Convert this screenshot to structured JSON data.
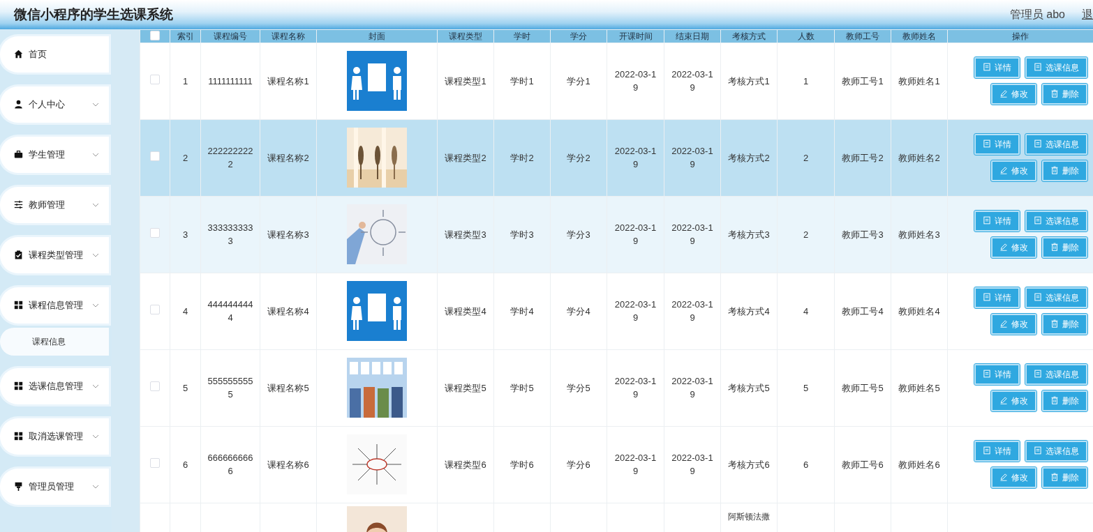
{
  "header": {
    "title": "微信小程序的学生选课系统",
    "user": "管理员 abo",
    "logout": "退"
  },
  "sidebar": {
    "items": [
      {
        "label": "首页",
        "kind": "home",
        "expandable": false
      },
      {
        "label": "个人中心",
        "kind": "person",
        "expandable": true
      },
      {
        "label": "学生管理",
        "kind": "briefcase",
        "expandable": true
      },
      {
        "label": "教师管理",
        "kind": "sliders",
        "expandable": true
      },
      {
        "label": "课程类型管理",
        "kind": "clipboard",
        "expandable": true
      },
      {
        "label": "课程信息管理",
        "kind": "grid",
        "expandable": true,
        "children": [
          {
            "label": "课程信息"
          }
        ]
      },
      {
        "label": "选课信息管理",
        "kind": "grid",
        "expandable": true
      },
      {
        "label": "取消选课管理",
        "kind": "grid",
        "expandable": true
      },
      {
        "label": "管理员管理",
        "kind": "pin",
        "expandable": true
      }
    ]
  },
  "table": {
    "header_checked": false,
    "columns": [
      "索引",
      "课程编号",
      "课程名称",
      "封面",
      "课程类型",
      "学时",
      "学分",
      "开课时间",
      "结束日期",
      "考核方式",
      "人数",
      "教师工号",
      "教师姓名",
      "操作"
    ],
    "rows": [
      {
        "checked": false,
        "selected": false,
        "hovered": false,
        "index": "1",
        "code": "1111111111",
        "name": "课程名称1",
        "type": "课程类型1",
        "hours": "学时1",
        "credits": "学分1",
        "start": "2022-03-19",
        "end": "2022-03-19",
        "assessment": "考核方式1",
        "count": "1",
        "teacher_id": "教师工号1",
        "teacher_name": "教师姓名1",
        "actions": [
          {
            "kind": "doc",
            "label": "详情"
          },
          {
            "kind": "doc",
            "label": "选课信息"
          },
          {
            "kind": "edit",
            "label": "修改"
          },
          {
            "kind": "delete",
            "label": "删除"
          }
        ]
      },
      {
        "checked": false,
        "selected": true,
        "hovered": false,
        "index": "2",
        "code": "2222222222",
        "name": "课程名称2",
        "type": "课程类型2",
        "hours": "学时2",
        "credits": "学分2",
        "start": "2022-03-19",
        "end": "2022-03-19",
        "assessment": "考核方式2",
        "count": "2",
        "teacher_id": "教师工号2",
        "teacher_name": "教师姓名2",
        "actions": [
          {
            "kind": "doc",
            "label": "详情"
          },
          {
            "kind": "doc",
            "label": "选课信息"
          },
          {
            "kind": "edit",
            "label": "修改"
          },
          {
            "kind": "delete",
            "label": "删除"
          }
        ]
      },
      {
        "checked": false,
        "selected": false,
        "hovered": true,
        "index": "3",
        "code": "3333333333",
        "name": "课程名称3",
        "type": "课程类型3",
        "hours": "学时3",
        "credits": "学分3",
        "start": "2022-03-19",
        "end": "2022-03-19",
        "assessment": "考核方式3",
        "count": "2",
        "teacher_id": "教师工号3",
        "teacher_name": "教师姓名3",
        "actions": [
          {
            "kind": "doc",
            "label": "详情"
          },
          {
            "kind": "doc",
            "label": "选课信息"
          },
          {
            "kind": "edit",
            "label": "修改"
          },
          {
            "kind": "delete",
            "label": "删除"
          }
        ]
      },
      {
        "checked": false,
        "selected": false,
        "hovered": false,
        "index": "4",
        "code": "4444444444",
        "name": "课程名称4",
        "type": "课程类型4",
        "hours": "学时4",
        "credits": "学分4",
        "start": "2022-03-19",
        "end": "2022-03-19",
        "assessment": "考核方式4",
        "count": "4",
        "teacher_id": "教师工号4",
        "teacher_name": "教师姓名4",
        "actions": [
          {
            "kind": "doc",
            "label": "详情"
          },
          {
            "kind": "doc",
            "label": "选课信息"
          },
          {
            "kind": "edit",
            "label": "修改"
          },
          {
            "kind": "delete",
            "label": "删除"
          }
        ]
      },
      {
        "checked": false,
        "selected": false,
        "hovered": false,
        "index": "5",
        "code": "5555555555",
        "name": "课程名称5",
        "type": "课程类型5",
        "hours": "学时5",
        "credits": "学分5",
        "start": "2022-03-19",
        "end": "2022-03-19",
        "assessment": "考核方式5",
        "count": "5",
        "teacher_id": "教师工号5",
        "teacher_name": "教师姓名5",
        "actions": [
          {
            "kind": "doc",
            "label": "详情"
          },
          {
            "kind": "doc",
            "label": "选课信息"
          },
          {
            "kind": "edit",
            "label": "修改"
          },
          {
            "kind": "delete",
            "label": "删除"
          }
        ]
      },
      {
        "checked": false,
        "selected": false,
        "hovered": false,
        "index": "6",
        "code": "6666666666",
        "name": "课程名称6",
        "type": "课程类型6",
        "hours": "学时6",
        "credits": "学分6",
        "start": "2022-03-19",
        "end": "2022-03-19",
        "assessment": "考核方式6",
        "count": "6",
        "teacher_id": "教师工号6",
        "teacher_name": "教师姓名6",
        "actions": [
          {
            "kind": "doc",
            "label": "详情"
          },
          {
            "kind": "doc",
            "label": "选课信息"
          },
          {
            "kind": "edit",
            "label": "修改"
          },
          {
            "kind": "delete",
            "label": "删除"
          }
        ]
      },
      {
        "assessment": "阿斯顿法撒"
      }
    ]
  }
}
